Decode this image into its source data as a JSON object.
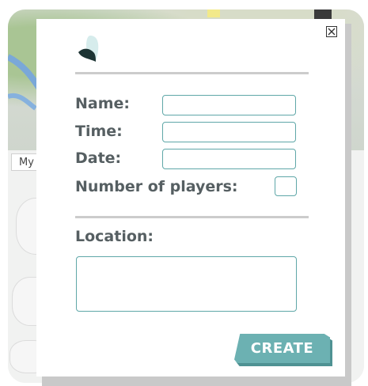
{
  "background": {
    "map_label": "My"
  },
  "modal": {
    "close_glyph": "✕",
    "labels": {
      "name": "Name:",
      "time": "Time:",
      "date": "Date:",
      "players": "Number of players:",
      "location": "Location:"
    },
    "fields": {
      "name": "",
      "time": "",
      "date": "",
      "location": ""
    },
    "players_checked": false,
    "create_label": "CREATE"
  },
  "colors": {
    "accent": "#6cb1b2",
    "field_border": "#5fa7a8",
    "label_text": "#565f62",
    "logo_dark": "#1f3a3a",
    "logo_light": "#cfe6e6"
  },
  "icons": {
    "logo": "app-logo-icon",
    "close": "close-icon"
  }
}
